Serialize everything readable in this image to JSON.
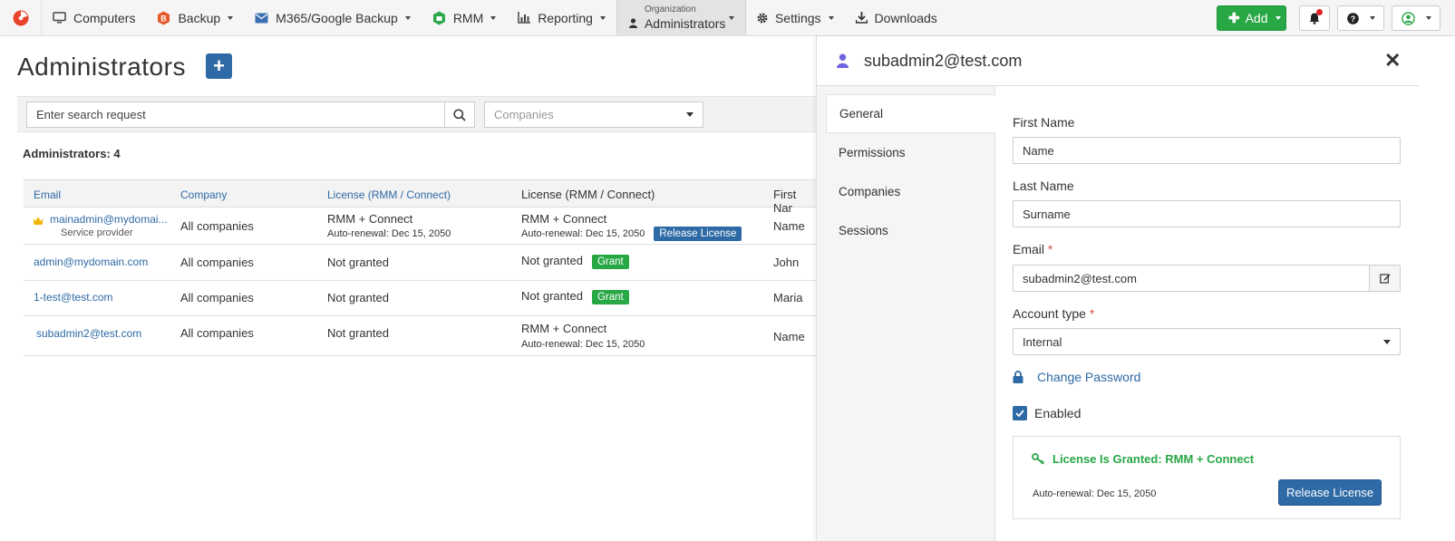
{
  "nav": {
    "items": [
      {
        "label": "Computers",
        "icon": "monitor-icon"
      },
      {
        "label": "Backup",
        "icon": "backup-icon"
      },
      {
        "label": "M365/Google Backup",
        "icon": "mail-icon"
      },
      {
        "label": "RMM",
        "icon": "rmm-icon"
      },
      {
        "label": "Reporting",
        "icon": "chart-icon"
      }
    ],
    "org_small": "Organization",
    "org_main": "Administrators",
    "settings": "Settings",
    "downloads": "Downloads",
    "add": "Add"
  },
  "page": {
    "title": "Administrators",
    "search_placeholder": "Enter search request",
    "companies_placeholder": "Companies",
    "count": "Administrators: 4"
  },
  "table": {
    "headers": [
      "Email",
      "Company",
      "License (RMM / Connect)",
      "License (RMM / Connect)",
      "First Nar"
    ],
    "rows": [
      {
        "email": "mainadmin@mydomai...",
        "role": "Service provider",
        "company": "All companies",
        "lic1": "RMM + Connect",
        "lic1_sub": "Auto-renewal:  Dec 15, 2050",
        "lic2": "RMM + Connect",
        "lic2_sub": "Auto-renewal:  Dec 15, 2050",
        "action": "Release License",
        "first": "Name"
      },
      {
        "email": "admin@mydomain.com",
        "company": "All companies",
        "lic1": "Not granted",
        "lic2": "Not granted",
        "action": "Grant",
        "first": "John"
      },
      {
        "email": "1-test@test.com",
        "company": "All companies",
        "lic1": "Not granted",
        "lic2": "Not granted",
        "action": "Grant",
        "first": "Maria"
      },
      {
        "email": "subadmin2@test.com",
        "company": "All companies",
        "lic1": "Not granted",
        "lic2": "RMM + Connect",
        "lic2_sub": "Auto-renewal:  Dec 15, 2050",
        "first": "Name"
      }
    ]
  },
  "panel": {
    "title": "subadmin2@test.com",
    "tabs": [
      "General",
      "Permissions",
      "Companies",
      "Sessions"
    ],
    "first_name_label": "First Name",
    "first_name_value": "Name",
    "last_name_label": "Last Name",
    "last_name_value": "Surname",
    "email_label": "Email",
    "email_value": "subadmin2@test.com",
    "account_type_label": "Account type",
    "account_type_value": "Internal",
    "change_password": "Change Password",
    "enabled": "Enabled",
    "license_title": "License Is Granted: RMM + Connect",
    "license_renewal": "Auto-renewal: Dec 15, 2050",
    "release_button": "Release License",
    "required_mark": "*"
  }
}
